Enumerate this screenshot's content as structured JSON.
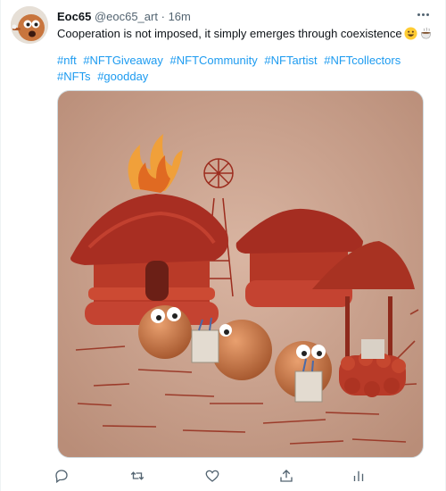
{
  "tweet": {
    "display_name": "Eoc65",
    "handle": "@eoc65_art",
    "separator": "·",
    "time": "16m",
    "text": "Cooperation is not imposed, it simply emerges through coexistence",
    "emojis": [
      "grinning-face",
      "hot-beverage"
    ],
    "hashtags": [
      "#nft",
      "#NFTGiveaway",
      "#NFTCommunity",
      "#NFTartist",
      "#NFTcollectors",
      "#NFTs",
      "#goodday"
    ]
  },
  "actions": [
    {
      "name": "reply",
      "icon": "reply-icon"
    },
    {
      "name": "retweet",
      "icon": "retweet-icon"
    },
    {
      "name": "like",
      "icon": "heart-icon"
    },
    {
      "name": "share",
      "icon": "share-icon"
    },
    {
      "name": "analytics",
      "icon": "analytics-icon"
    }
  ],
  "colors": {
    "link": "#1d9bf0",
    "secondary_text": "#536471",
    "primary_text": "#0f1419",
    "border": "#cfd9de"
  }
}
